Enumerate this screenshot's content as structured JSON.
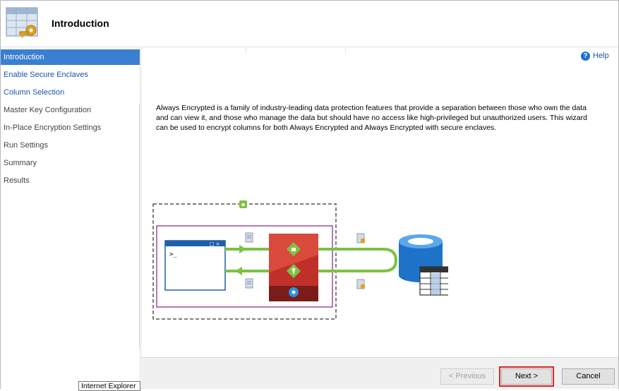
{
  "header": {
    "title": "Introduction",
    "icon": "wizard-table-key-icon"
  },
  "sidebar": {
    "items": [
      {
        "label": "Introduction",
        "state": "active"
      },
      {
        "label": "Enable Secure Enclaves",
        "state": "link"
      },
      {
        "label": "Column Selection",
        "state": "link"
      },
      {
        "label": "Master Key Configuration",
        "state": "normal"
      },
      {
        "label": "In-Place Encryption Settings",
        "state": "normal"
      },
      {
        "label": "Run Settings",
        "state": "normal"
      },
      {
        "label": "Summary",
        "state": "normal"
      },
      {
        "label": "Results",
        "state": "normal"
      }
    ]
  },
  "tooltip": {
    "text": "Internet Explorer"
  },
  "help": {
    "label": "Help",
    "icon": "help-icon"
  },
  "main": {
    "description": "Always Encrypted is a family of industry-leading data protection features that provide a separation between those who own the data and can view it, and those who manage the data but should have no access like high-privileged but unauthorized users. This wizard can be used to encrypt columns for both Always Encrypted and Always Encrypted with secure enclaves.",
    "diagram": {
      "console_prompt": ">_",
      "window_controls": "_ □ ×"
    }
  },
  "footer": {
    "previous_label": "< Previous",
    "next_label": "Next >",
    "cancel_label": "Cancel"
  },
  "colors": {
    "accent": "#3b7fd1",
    "link": "#1a56a6",
    "enclave_purple": "#9b4f9b",
    "driver_red": "#c0302a",
    "arrow_green": "#7cc242",
    "database_blue": "#1e73c9",
    "highlight_red": "#d9262b"
  }
}
